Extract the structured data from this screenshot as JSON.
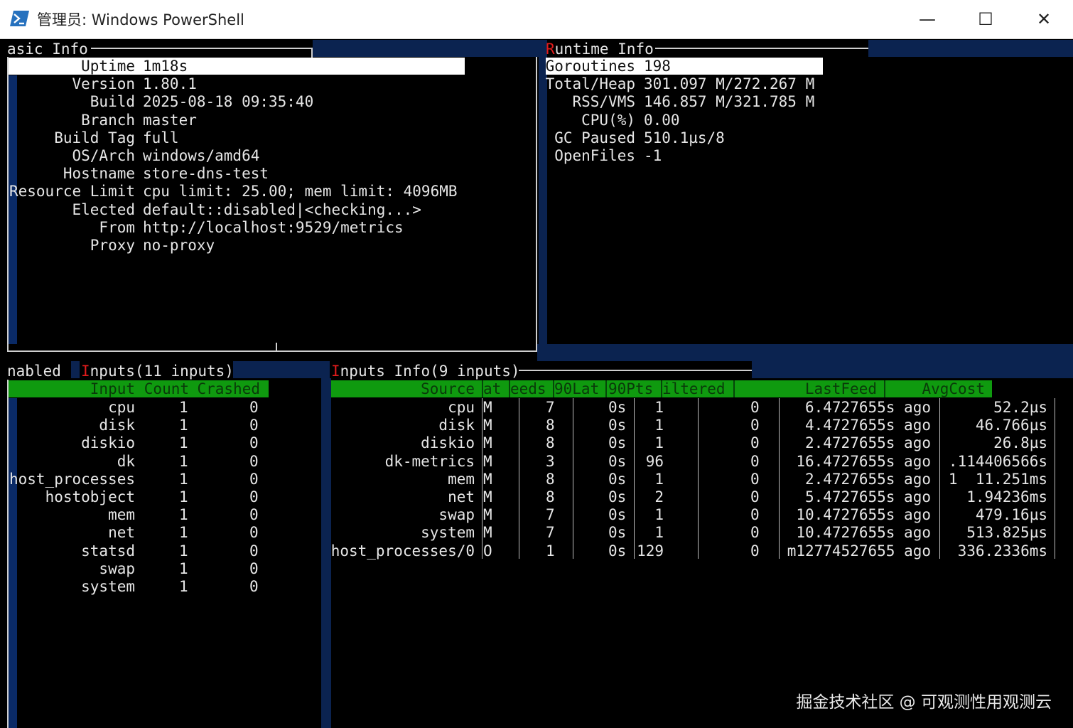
{
  "window": {
    "title": "管理员: Windows PowerShell",
    "controls": {
      "minimize": "—",
      "maximize": "☐",
      "close": "✕"
    }
  },
  "basic_info": {
    "title": "asic Info",
    "rows": [
      {
        "key": "Uptime",
        "value": "1m18s"
      },
      {
        "key": "Version",
        "value": "1.80.1"
      },
      {
        "key": "Build",
        "value": "2025-08-18 09:35:40"
      },
      {
        "key": "Branch",
        "value": "master"
      },
      {
        "key": "Build Tag",
        "value": "full"
      },
      {
        "key": "OS/Arch",
        "value": "windows/amd64"
      },
      {
        "key": "Hostname",
        "value": "store-dns-test"
      },
      {
        "key": "Resource Limit",
        "value": "cpu limit: 25.00; mem limit: 4096MB"
      },
      {
        "key": "Elected",
        "value": "default::disabled|<checking...>"
      },
      {
        "key": "From",
        "value": "http://localhost:9529/metrics"
      },
      {
        "key": "Proxy",
        "value": "no-proxy"
      }
    ]
  },
  "runtime_info": {
    "title_first": "R",
    "title_rest": "untime Info",
    "rows": [
      {
        "key": "Goroutines",
        "value": "198"
      },
      {
        "key": "Total/Heap",
        "value": "301.097 M/272.267 M"
      },
      {
        "key": "RSS/VMS",
        "value": "146.857 M/321.785 M"
      },
      {
        "key": "CPU(%)",
        "value": "0.00"
      },
      {
        "key": "GC Paused",
        "value": "510.1µs/8"
      },
      {
        "key": "OpenFiles",
        "value": "-1"
      }
    ]
  },
  "inputs_tabs": {
    "enabled": "nabled",
    "inputs_first": "I",
    "inputs_rest": "nputs(11 inputs)"
  },
  "inputs_table": {
    "headers": [
      "Input",
      "Count",
      "Crashed"
    ],
    "rows": [
      [
        "cpu",
        "1",
        "0"
      ],
      [
        "disk",
        "1",
        "0"
      ],
      [
        "diskio",
        "1",
        "0"
      ],
      [
        "dk",
        "1",
        "0"
      ],
      [
        "host_processes",
        "1",
        "0"
      ],
      [
        "hostobject",
        "1",
        "0"
      ],
      [
        "mem",
        "1",
        "0"
      ],
      [
        "net",
        "1",
        "0"
      ],
      [
        "statsd",
        "1",
        "0"
      ],
      [
        "swap",
        "1",
        "0"
      ],
      [
        "system",
        "1",
        "0"
      ]
    ]
  },
  "inputs_info": {
    "title_first": "I",
    "title_rest": "nputs Info(9 inputs)",
    "headers": [
      "Source",
      "at",
      "eeds",
      "90Lat",
      "90Pts",
      "iltered",
      "LastFeed",
      "AvgCost"
    ],
    "rows": [
      [
        "cpu",
        "M",
        "7",
        "0s",
        "1",
        "0",
        "6.4727655s ago",
        "52.2µs"
      ],
      [
        "disk",
        "M",
        "8",
        "0s",
        "1",
        "0",
        "4.4727655s ago",
        "46.766µs"
      ],
      [
        "diskio",
        "M",
        "8",
        "0s",
        "1",
        "0",
        "2.4727655s ago",
        "26.8µs"
      ],
      [
        "dk-metrics",
        "M",
        "3",
        "0s",
        "96",
        "0",
        "16.4727655s ago",
        ".114406566s"
      ],
      [
        "mem",
        "M",
        "8",
        "0s",
        "1",
        "0",
        "2.4727655s ago",
        "1  11.251ms"
      ],
      [
        "net",
        "M",
        "8",
        "0s",
        "2",
        "0",
        "5.4727655s ago",
        "1.94236ms"
      ],
      [
        "swap",
        "M",
        "7",
        "0s",
        "1",
        "0",
        "10.4727655s ago",
        "479.16µs"
      ],
      [
        "system",
        "M",
        "7",
        "0s",
        "1",
        "0",
        "10.4727655s ago",
        "513.825µs"
      ],
      [
        "host_processes/0",
        "O",
        "1",
        "0s",
        "129",
        "0",
        "m12774527655 ago",
        "336.2336ms"
      ]
    ]
  },
  "watermark": "掘金技术社区 @ 可观测性用观测云",
  "colors": {
    "navy": "#0b2350",
    "green": "#0f9a0f",
    "highlight_red": "#e31b1b",
    "text": "#e6e6e6"
  }
}
